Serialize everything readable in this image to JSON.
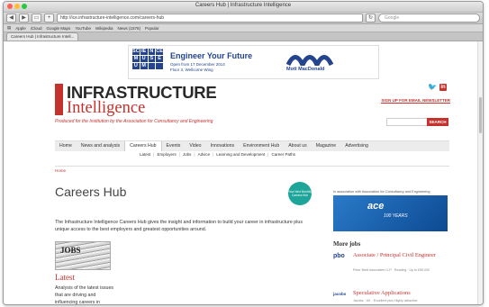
{
  "window": {
    "title": "Careers Hub | Infrastructure Intelligence",
    "url": "http://ice.infrastructure-intelligence.com/careers-hub",
    "search_placeholder": "Google"
  },
  "bookmarks": [
    "Apple",
    "iCloud",
    "Google Maps",
    "YouTube",
    "Wikipedia",
    "News (1578)",
    "Popular"
  ],
  "tab": {
    "label": "Careers Hub | Infrastructure Intell..."
  },
  "ad": {
    "grid_letters": [
      "SC",
      "IE",
      "N",
      "CE",
      "M",
      "U",
      "S",
      "E",
      "U",
      "M",
      "",
      ""
    ],
    "headline": "Engineer Your Future",
    "sub1": "Open from 17 December 2014",
    "sub2": "Floor 3, Wellcome Wing",
    "sponsor": "Mott MacDonald"
  },
  "logo": {
    "line1": "INFRASTRUCTURE",
    "line2": "Intelligence",
    "tagline": "Produced for the Institution by the Association for Consultancy and Engineering"
  },
  "newsletter_link": "SIGN UP FOR EMAIL NEWSLETTER",
  "search": {
    "button": "SEARCH"
  },
  "mainnav": [
    "Home",
    "News and analysis",
    "Careers Hub",
    "Events",
    "Video",
    "Innovations",
    "Environment Hub",
    "About us",
    "Magazine",
    "Advertising"
  ],
  "mainnav_active": "Careers Hub",
  "subnav": [
    "Latest",
    "Employers",
    "Jobs",
    "Advice",
    "Learning and Development",
    "Career Paths"
  ],
  "breadcrumb": "Home",
  "page": {
    "title": "Careers Hub",
    "badge": "Your Next Monthly Careers Hub",
    "intro": "The Infrastructure Intelligence Careers Hub gives the insight and information to build your career in infrastructure plus unique access to the best employers and greatest opportunities around."
  },
  "latest": {
    "img_text": "JOBS",
    "heading": "Latest",
    "text": "Analysis of the latest issues that are driving and influencing careers in"
  },
  "sidebar": {
    "ace_caption": "In association with Association for Consultancy and Engineering",
    "ace_name": "ace",
    "ace_sub": "100 YEARS",
    "morejobs_heading": "More jobs",
    "jobs": [
      {
        "logo": "pbo",
        "title": "Associate / Principal Civil Engineer",
        "meta": "Peter Brett Associates LLP · Reading · Up to £55,000"
      },
      {
        "logo": "jacobs",
        "title": "Speculative Applications",
        "meta": "Jacobs · UK · Excellent plus Highly attractive"
      }
    ]
  },
  "colors": {
    "brand_red": "#c4322e",
    "teal": "#1ea59a",
    "navy": "#24448e"
  }
}
